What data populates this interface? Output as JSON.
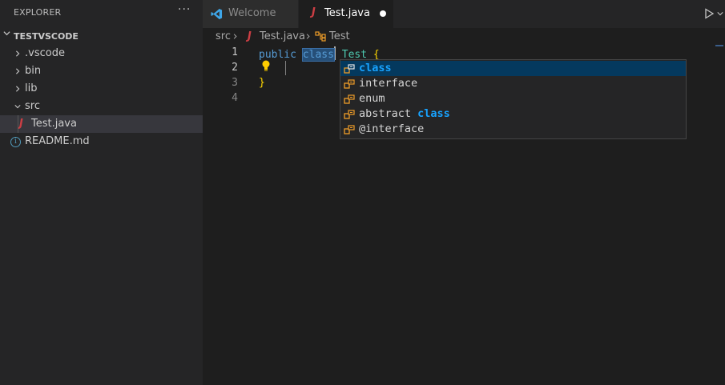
{
  "sidebar": {
    "title": "EXPLORER",
    "more": "···",
    "section": "TESTVSCODE",
    "items": [
      {
        "label": ".vscode"
      },
      {
        "label": "bin"
      },
      {
        "label": "lib"
      },
      {
        "label": "src"
      },
      {
        "label": "Test.java"
      },
      {
        "label": "README.md"
      }
    ]
  },
  "tabs": [
    {
      "label": "Welcome",
      "active": false
    },
    {
      "label": "Test.java",
      "active": true,
      "dirty": true
    }
  ],
  "breadcrumb": {
    "folder": "src",
    "file": "Test.java",
    "symbol": "Test"
  },
  "editor": {
    "line_numbers": [
      "1",
      "2",
      "3",
      "4"
    ],
    "line1": {
      "kw": "public",
      "selected": "class",
      "name": "Test",
      "brace": "{"
    },
    "line3": {
      "brace": "}"
    }
  },
  "suggestions": [
    {
      "text": "",
      "match": "class",
      "focused": true
    },
    {
      "text": "interface",
      "match": ""
    },
    {
      "text": "enum",
      "match": ""
    },
    {
      "text": "abstract ",
      "match": "class"
    },
    {
      "text": "@interface",
      "match": ""
    }
  ],
  "icons": {
    "java": "J",
    "info": "i",
    "keyword_icon": "keyword-snippet-icon",
    "run": "play-icon"
  },
  "colors": {
    "keyword": "#569cd6",
    "type": "#4ec9b0",
    "brace": "#ffd700",
    "match_highlight": "#18a3ff",
    "focused_row": "#04395e",
    "java": "#cc3e44"
  }
}
